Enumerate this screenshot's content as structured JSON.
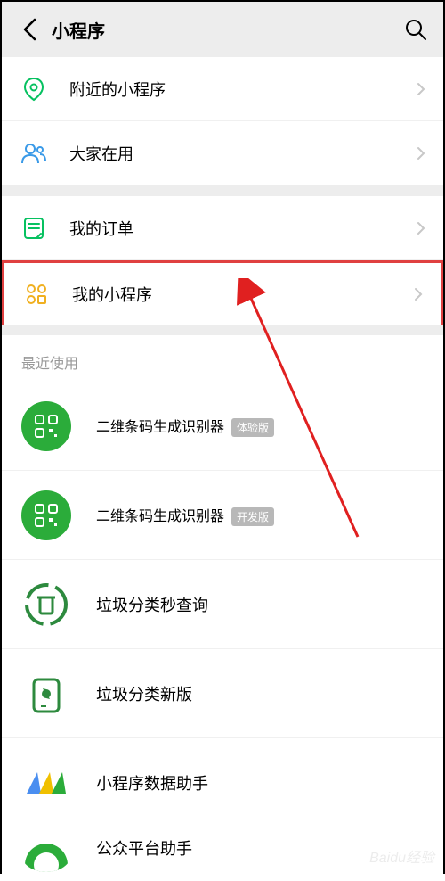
{
  "header": {
    "title": "小程序"
  },
  "menu": {
    "nearby": "附近的小程序",
    "everyone": "大家在用",
    "orders": "我的订单",
    "my_apps": "我的小程序"
  },
  "recent": {
    "header": "最近使用",
    "items": [
      {
        "name": "二维条码生成识别器",
        "badge": "体验版",
        "icon": "qr-green"
      },
      {
        "name": "二维条码生成识别器",
        "badge": "开发版",
        "icon": "qr-green"
      },
      {
        "name": "垃圾分类秒查询",
        "badge": null,
        "icon": "recycle"
      },
      {
        "name": "垃圾分类新版",
        "badge": null,
        "icon": "trash"
      },
      {
        "name": "小程序数据助手",
        "badge": null,
        "icon": "wave"
      },
      {
        "name": "公众平台助手",
        "badge": null,
        "icon": "half-green"
      }
    ]
  },
  "watermark": "Baidu经验"
}
